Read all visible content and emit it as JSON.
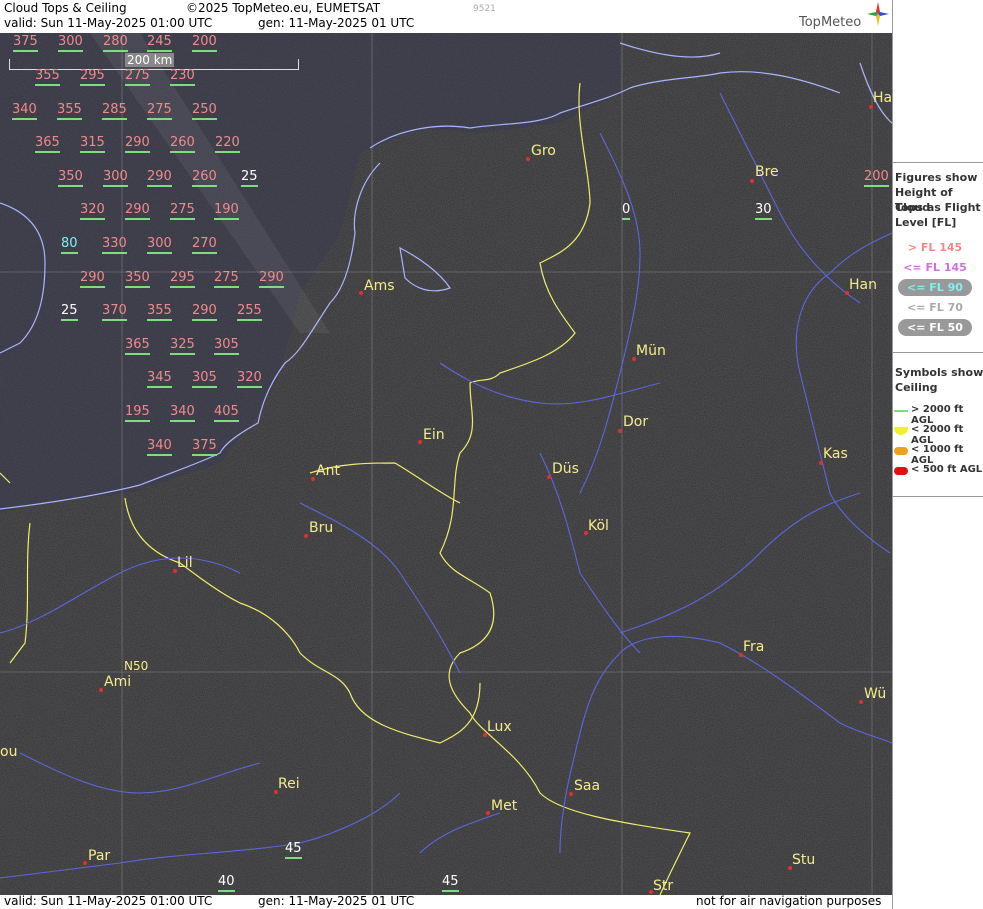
{
  "header": {
    "title": "Cloud Tops & Ceiling",
    "copyright": "©2025 TopMeteo.eu, EUMETSAT",
    "code": "9521",
    "valid": "valid:  Sun  11-May-2025  01:00 UTC",
    "gen": "gen: 11-May-2025 01 UTC",
    "brand": "TopMeteo"
  },
  "footer": {
    "valid": "valid:  Sun  11-May-2025  01:00 UTC",
    "gen": "gen: 11-May-2025 01 UTC",
    "note": "not for air navigation purposes"
  },
  "scale": {
    "label": "200 km"
  },
  "grid_label": "N50",
  "cloud_tops": {
    "red": [
      "375",
      "300",
      "280",
      "245",
      "200",
      "355",
      "295",
      "275",
      "230",
      "340",
      "355",
      "285",
      "275",
      "250",
      "365",
      "315",
      "290",
      "260",
      "220",
      "350",
      "300",
      "290",
      "260",
      "320",
      "290",
      "275",
      "190",
      "330",
      "300",
      "270",
      "290",
      "350",
      "295",
      "275",
      "290",
      "370",
      "355",
      "290",
      "255",
      "365",
      "325",
      "305",
      "345",
      "305",
      "320",
      "195",
      "340",
      "405",
      "340",
      "375",
      "200"
    ],
    "white": [
      "25",
      "0",
      "30",
      "45",
      "40",
      "45"
    ],
    "cyan": [
      "80"
    ],
    "cyan2": [
      "25"
    ]
  },
  "cities": [
    "Gro",
    "Bre",
    "Ha",
    "Ams",
    "Han",
    "Mün",
    "Ein",
    "Dor",
    "Ant",
    "Düs",
    "Kas",
    "Bru",
    "Köl",
    "Lil",
    "Fra",
    "Ami",
    "Wü",
    "Lux",
    "ou",
    "Rei",
    "Saa",
    "Met",
    "Par",
    "Stu",
    "Str"
  ],
  "legend": {
    "figures_title": [
      "Figures show",
      "Height of Cloud",
      "Tops as Flight",
      "Level  [FL]"
    ],
    "fl_items": [
      "> FL 145",
      "<= FL 145",
      "<= FL 90",
      "<= FL 70",
      "<= FL 50"
    ],
    "symbols_title": [
      "Symbols show",
      "Ceiling"
    ],
    "ceiling_items": [
      "> 2000 ft AGL",
      "< 2000 ft AGL",
      "< 1000 ft AGL",
      "< 500 ft AGL"
    ],
    "colors": {
      "fl145_up": "#f08a8a",
      "fl145": "#d070e0",
      "fl90": "#7ff0f0",
      "fl70": "#aaaaaa",
      "fl50": "#ffffff",
      "ceil2000up": "#7be07b",
      "ceil2000": "#f0f030",
      "ceil1000": "#f0a020",
      "ceil500": "#e01010"
    }
  }
}
